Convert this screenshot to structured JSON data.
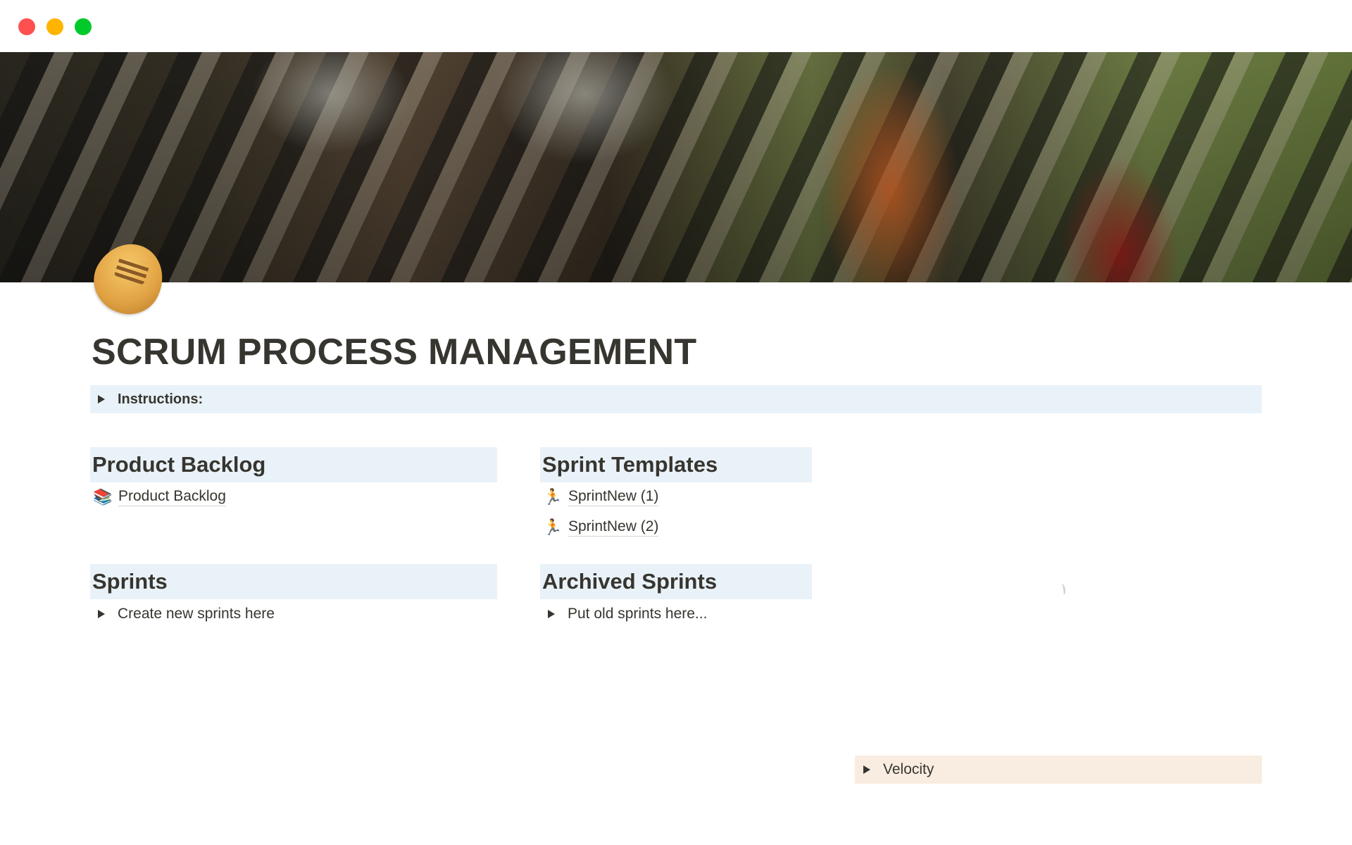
{
  "window": {
    "controls": [
      "close",
      "minimize",
      "maximize"
    ]
  },
  "cover": {
    "description": "rugby scrum photo"
  },
  "page": {
    "icon": "rugby-football-icon",
    "title": "SCRUM PROCESS MANAGEMENT"
  },
  "instructions": {
    "label": "Instructions:"
  },
  "sections": {
    "product_backlog": {
      "heading": "Product Backlog",
      "links": [
        {
          "emoji": "📚",
          "icon": "books-icon",
          "label": "Product Backlog"
        }
      ]
    },
    "sprint_templates": {
      "heading": "Sprint Templates",
      "links": [
        {
          "emoji": "🏃",
          "icon": "runner-icon",
          "label": "SprintNew (1)"
        },
        {
          "emoji": "🏃",
          "icon": "runner-icon",
          "label": "SprintNew (2)"
        }
      ]
    },
    "sprints": {
      "heading": "Sprints",
      "toggle_label": "Create new sprints here"
    },
    "archived_sprints": {
      "heading": "Archived Sprints",
      "toggle_label": "Put old sprints here..."
    }
  },
  "velocity": {
    "label": "Velocity"
  },
  "colors": {
    "text": "#37352f",
    "heading_bg": "#e9f2f8",
    "velocity_bg": "#f9ece0",
    "close": "#ff5050",
    "minimize": "#ffb400",
    "maximize": "#00c92b"
  }
}
